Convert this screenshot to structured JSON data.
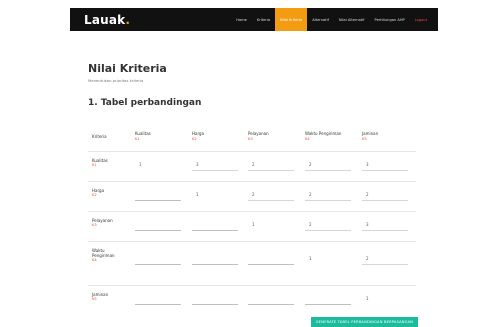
{
  "navbar": {
    "brand_main": "Lauak",
    "brand_accent": ".",
    "items": [
      {
        "label": "Home"
      },
      {
        "label": "Kriteria"
      },
      {
        "label": "Nilai Kriteria"
      },
      {
        "label": "Alternatif"
      },
      {
        "label": "Nilai Alternatif"
      },
      {
        "label": "Perhitungan AHP"
      },
      {
        "label": "Logout"
      }
    ],
    "active_index": 2,
    "colors": {
      "accent": "#f39c12",
      "bar": "#111111",
      "logout": "#e74c3c"
    }
  },
  "page": {
    "title": "Nilai Kriteria",
    "subtitle": "Menentukan prioritas kriteria",
    "section_title": "1. Tabel perbandingan"
  },
  "table": {
    "header_label": "Kriteria",
    "columns": [
      {
        "name": "Kualitas",
        "code": "K1"
      },
      {
        "name": "Harga",
        "code": "K2"
      },
      {
        "name": "Pelayanan",
        "code": "K3"
      },
      {
        "name": "Waktu Pengiriman",
        "code": "K4"
      },
      {
        "name": "Jaminan",
        "code": "K5"
      }
    ],
    "rows": [
      {
        "name": "Kualitas",
        "code": "K1",
        "values": [
          "1",
          "3",
          "2",
          "2",
          "3"
        ]
      },
      {
        "name": "Harga",
        "code": "K2",
        "values": [
          "",
          "1",
          "2",
          "2",
          "2"
        ]
      },
      {
        "name": "Pelayanan",
        "code": "K3",
        "values": [
          "",
          "",
          "1",
          "2",
          "3"
        ]
      },
      {
        "name": "Waktu Pengiriman",
        "code": "K4",
        "values": [
          "",
          "",
          "",
          "1",
          "2"
        ]
      },
      {
        "name": "Jaminan",
        "code": "K5",
        "values": [
          "",
          "",
          "",
          "",
          "1"
        ]
      }
    ]
  },
  "submit_label": "GENERATE TABEL PERBANDINGAN BERPASANGAN",
  "colors": {
    "code": "#e74c3c",
    "button": "#1abc9c"
  }
}
